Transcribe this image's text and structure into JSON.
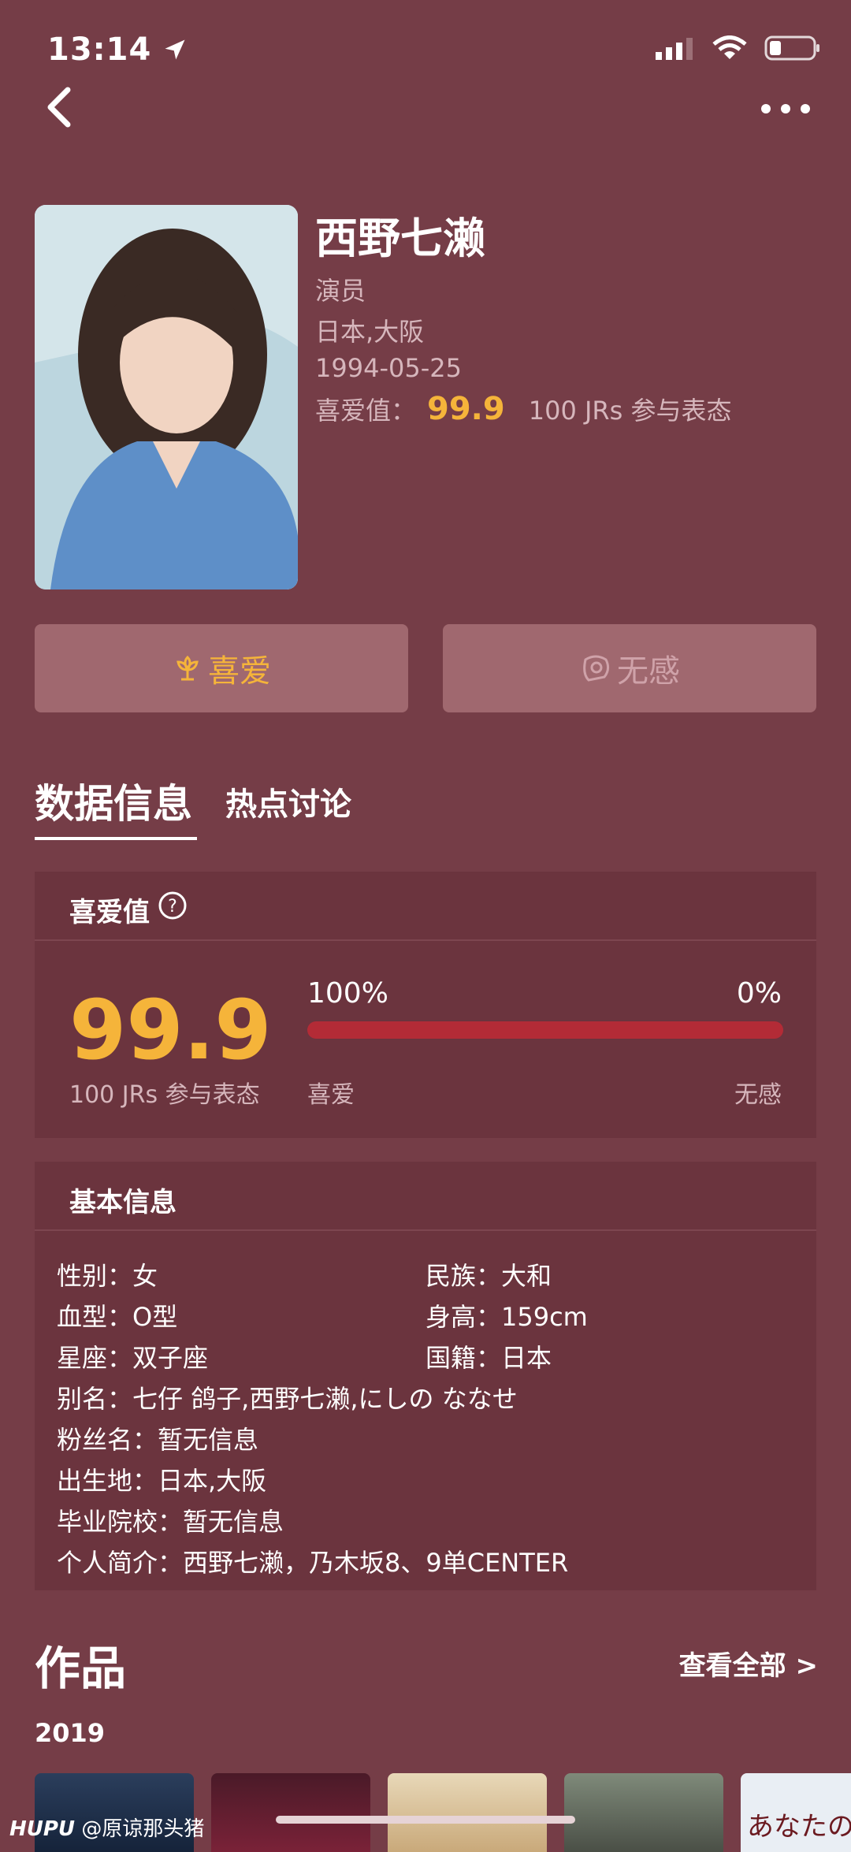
{
  "status_bar": {
    "time": "13:14"
  },
  "profile": {
    "name": "西野七濑",
    "role": "演员",
    "origin": "日本,大阪",
    "birthday": "1994-05-25",
    "love_label": "喜爱值：",
    "love_score": "99.9",
    "participants": "100 JRs 参与表态"
  },
  "actions": {
    "like_label": "喜爱",
    "meh_label": "无感"
  },
  "tabs": [
    {
      "label": "数据信息"
    },
    {
      "label": "热点讨论"
    }
  ],
  "love_card": {
    "title": "喜爱值",
    "score": "99.9",
    "participants": "100 JRs 参与表态",
    "like_pct": "100%",
    "meh_pct": "0%",
    "like_fraction": 1.0,
    "like_label": "喜爱",
    "meh_label": "无感"
  },
  "basic_card": {
    "title": "基本信息",
    "gender": "性别：女",
    "ethnicity": "民族：大和",
    "blood": "血型：O型",
    "height": "身高：159cm",
    "zodiac": "星座：双子座",
    "nationality": "国籍：日本",
    "alias": "别名：七仔 鸽子,西野七濑,にしの ななせ",
    "fan_name": "粉丝名：暂无信息",
    "birthplace": "出生地：日本,大阪",
    "school": "毕业院校：暂无信息",
    "intro": "个人简介：西野七濑，乃木坂8、9单CENTER"
  },
  "works": {
    "title": "作品",
    "view_all": "查看全部 >",
    "year": "2019",
    "thumb_text": "あなたの番"
  },
  "watermark": {
    "brand": "HUPU",
    "user": "@原谅那头猪"
  },
  "colors": {
    "background": "#753d47",
    "card": "#6b343e",
    "accent": "#f5b43a",
    "bar": "#b32b36"
  }
}
